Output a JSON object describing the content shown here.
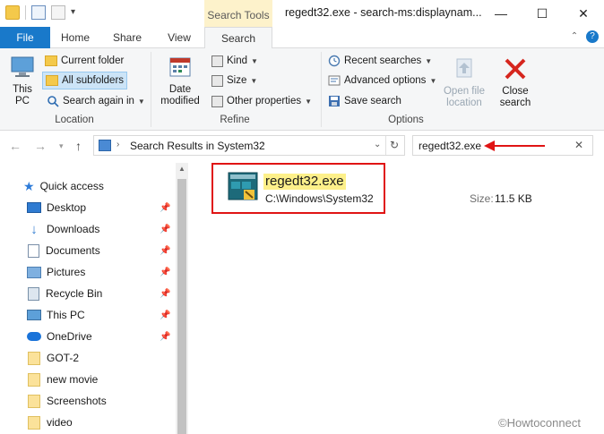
{
  "title_bar": {
    "context_tab": "Search Tools",
    "window_title": "regedt32.exe - search-ms:displaynam...",
    "minimize": "—",
    "maximize": "☐",
    "close": "✕"
  },
  "ribbon_tabs": {
    "file": "File",
    "home": "Home",
    "share": "Share",
    "view": "View",
    "search": "Search"
  },
  "ribbon": {
    "location": {
      "this_pc": "This PC",
      "current_folder": "Current folder",
      "all_subfolders": "All subfolders",
      "search_again_in": "Search again in",
      "group_label": "Location"
    },
    "refine": {
      "date_modified": "Date modified",
      "kind": "Kind",
      "size": "Size",
      "other_properties": "Other properties",
      "group_label": "Refine"
    },
    "options": {
      "recent_searches": "Recent searches",
      "advanced_options": "Advanced options",
      "save_search": "Save search",
      "open_file_location": "Open file location",
      "close_search": "Close search",
      "group_label": "Options"
    }
  },
  "address_bar": {
    "path": "Search Results in System32",
    "search_value": "regedt32.exe"
  },
  "nav_pane": [
    {
      "label": "Quick access",
      "icon": "star-icon"
    },
    {
      "label": "Desktop",
      "icon": "desktop-icon",
      "pinned": true
    },
    {
      "label": "Downloads",
      "icon": "download-icon",
      "pinned": true
    },
    {
      "label": "Documents",
      "icon": "document-icon",
      "pinned": true
    },
    {
      "label": "Pictures",
      "icon": "pictures-icon",
      "pinned": true
    },
    {
      "label": "Recycle Bin",
      "icon": "recycle-bin-icon",
      "pinned": true
    },
    {
      "label": "This PC",
      "icon": "computer-icon",
      "pinned": true
    },
    {
      "label": "OneDrive",
      "icon": "cloud-icon",
      "pinned": true
    },
    {
      "label": "GOT-2",
      "icon": "folder-icon"
    },
    {
      "label": "new movie",
      "icon": "folder-icon"
    },
    {
      "label": "Screenshots",
      "icon": "folder-icon"
    },
    {
      "label": "video",
      "icon": "folder-icon"
    }
  ],
  "result": {
    "name": "regedt32.exe",
    "path": "C:\\Windows\\System32",
    "size_label": "Size:",
    "size_value": "11.5 KB"
  },
  "watermark": "©Howtoconnect",
  "colors": {
    "file_tab": "#1979ca",
    "highlight": "#fdf08a",
    "annotation": "#e01414",
    "context_tab": "#fdf2cb"
  }
}
